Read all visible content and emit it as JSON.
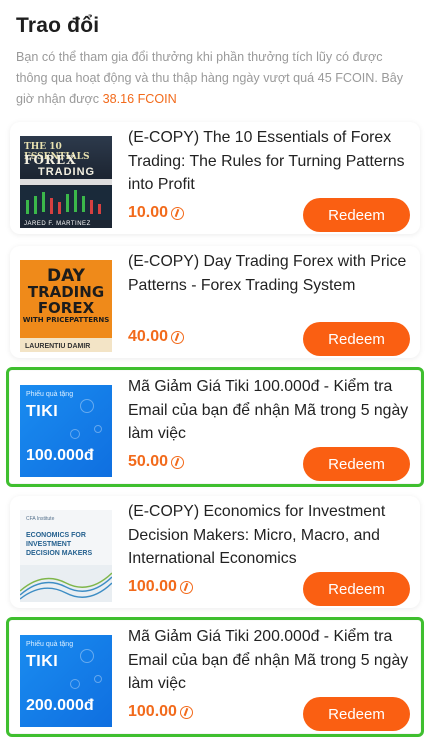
{
  "header": {
    "title": "Trao đổi",
    "description": "Bạn có thể tham gia đổi thưởng khi phần thưởng tích lũy có được thông qua hoạt động và thu thập hàng ngày vượt quá 45 FCOIN. Bây giờ nhận được",
    "current_amount": "38.16 FCOIN"
  },
  "items": [
    {
      "name": "(E-COPY) The 10 Essentials of Forex Trading: The Rules for Turning Patterns into Profit",
      "price": "10.00",
      "button": "Redeem",
      "cover": {
        "line1": "THE 10 ESSENTIALS",
        "line2": "FOREX",
        "line3": "TRADING",
        "author": "JARED F. MARTINEZ"
      }
    },
    {
      "name": "(E-COPY) Day Trading Forex with Price Patterns - Forex Trading System",
      "price": "40.00",
      "button": "Redeem",
      "cover": {
        "line1": "DAY",
        "line2": "TRADING",
        "line3": "FOREX",
        "line4": "WITH PRICEPATTERNS",
        "author": "LAURENTIU DAMIR"
      }
    },
    {
      "name": "Mã Giảm Giá Tiki 100.000đ - Kiểm tra Email của bạn để nhận Mã trong 5 ngày làm việc",
      "price": "50.00",
      "button": "Redeem",
      "cover": {
        "small": "Phiếu quà tặng",
        "logo": "TIKI",
        "value": "100.000đ"
      }
    },
    {
      "name": "(E-COPY) Economics for Investment Decision Makers: Micro, Macro, and International Economics",
      "price": "100.00",
      "button": "Redeem",
      "cover": {
        "head": "CFA Institute",
        "line1": "ECONOMICS FOR",
        "line2": "INVESTMENT",
        "line3": "DECISION MAKERS"
      }
    },
    {
      "name": "Mã Giảm Giá Tiki 200.000đ - Kiểm tra Email của bạn để nhận Mã trong 5 ngày làm việc",
      "price": "100.00",
      "button": "Redeem",
      "cover": {
        "small": "Phiếu quà tặng",
        "logo": "TIKI",
        "value": "200.000đ"
      }
    }
  ],
  "icons": {
    "price_icon": "fcoin-icon"
  },
  "colors": {
    "accent": "#fa5f12",
    "price": "#f26a1b",
    "highlight": "#3fbf2f"
  }
}
